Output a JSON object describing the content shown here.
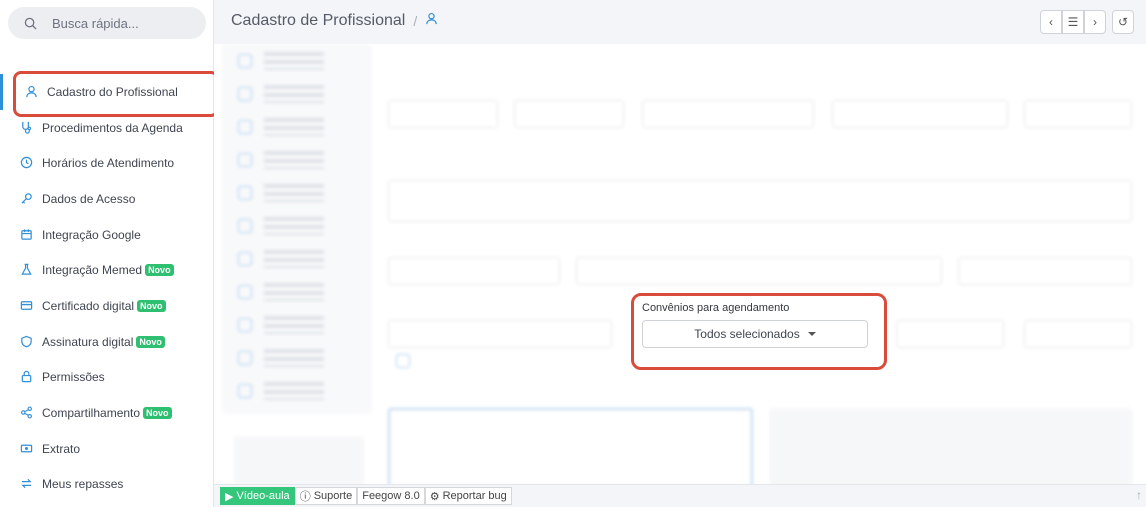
{
  "search": {
    "placeholder": "Busca rápida..."
  },
  "sidebar": {
    "items": [
      {
        "label": "Cadastro do Profissional",
        "icon": "user-icon"
      },
      {
        "label": "Procedimentos da Agenda",
        "icon": "stethoscope-icon"
      },
      {
        "label": "Horários de Atendimento",
        "icon": "clock-icon"
      },
      {
        "label": "Dados de Acesso",
        "icon": "key-icon"
      },
      {
        "label": "Integração Google",
        "icon": "calendar-icon"
      },
      {
        "label": "Integração Memed",
        "icon": "flask-icon",
        "badge": "Novo"
      },
      {
        "label": "Certificado digital",
        "icon": "card-icon",
        "badge": "Novo"
      },
      {
        "label": "Assinatura digital",
        "icon": "shield-icon",
        "badge": "Novo"
      },
      {
        "label": "Permissões",
        "icon": "lock-icon"
      },
      {
        "label": "Compartilhamento",
        "icon": "share-icon",
        "badge": "Novo"
      },
      {
        "label": "Extrato",
        "icon": "money-icon"
      },
      {
        "label": "Meus repasses",
        "icon": "transfer-icon"
      }
    ]
  },
  "header": {
    "title": "Cadastro de Profissional",
    "separator": "/"
  },
  "convenios": {
    "label": "Convênios para agendamento",
    "value": "Todos selecionados"
  },
  "footer": {
    "video": "Vídeo-aula",
    "suporte": "Suporte",
    "version": "Feegow 8.0",
    "bug": "Reportar bug"
  },
  "colors": {
    "accent": "#2f8fd8",
    "highlight": "#d94b3b",
    "badge": "#2fbf71"
  }
}
